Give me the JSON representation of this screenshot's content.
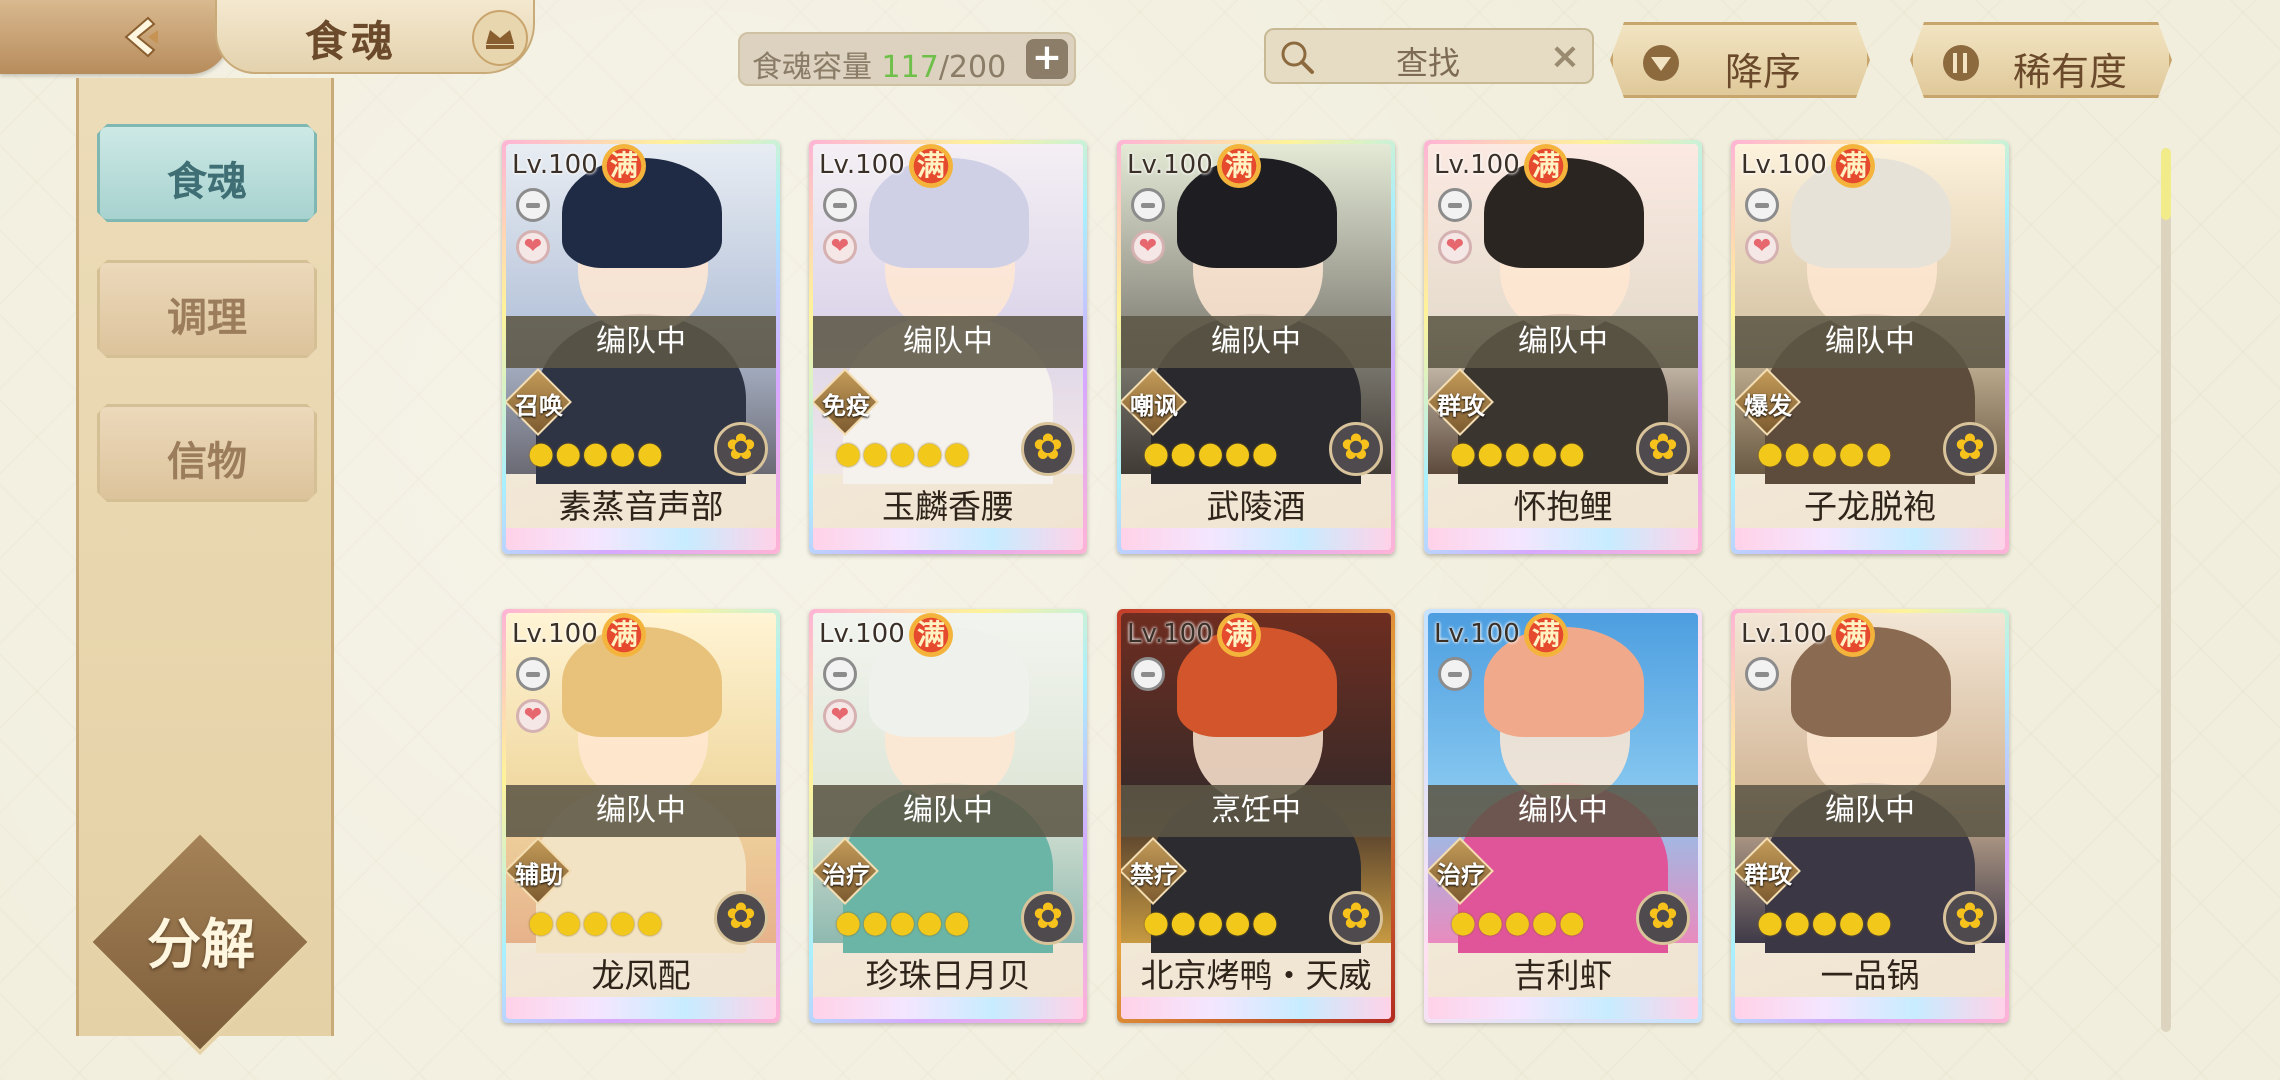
{
  "header": {
    "title": "食魂",
    "capacity_label": "食魂容量",
    "capacity_used": "117",
    "capacity_total": "200",
    "capacity_plus": "+",
    "search_placeholder": "查找",
    "search_clear": "×",
    "sort_label": "降序",
    "rarity_label": "稀有度"
  },
  "sidebar": {
    "items": [
      {
        "label": "食魂",
        "active": true
      },
      {
        "label": "调理",
        "active": false
      },
      {
        "label": "信物",
        "active": false
      }
    ],
    "decompose_label": "分解"
  },
  "common": {
    "max_badge": "满",
    "heart": "❤",
    "flower": "✿",
    "stars": "●●●●●"
  },
  "cards": [
    {
      "level": "Lv.100",
      "status": "编队中",
      "skill": "召唤",
      "name": "素蒸音声部"
    },
    {
      "level": "Lv.100",
      "status": "编队中",
      "skill": "免疫",
      "name": "玉麟香腰"
    },
    {
      "level": "Lv.100",
      "status": "编队中",
      "skill": "嘲讽",
      "name": "武陵酒"
    },
    {
      "level": "Lv.100",
      "status": "编队中",
      "skill": "群攻",
      "name": "怀抱鲤"
    },
    {
      "level": "Lv.100",
      "status": "编队中",
      "skill": "爆发",
      "name": "子龙脱袍"
    },
    {
      "level": "Lv.100",
      "status": "编队中",
      "skill": "辅助",
      "name": "龙凤配"
    },
    {
      "level": "Lv.100",
      "status": "编队中",
      "skill": "治疗",
      "name": "珍珠日月贝"
    },
    {
      "level": "Lv.100",
      "status": "烹饪中",
      "skill": "禁疗",
      "name": "北京烤鸭・天威"
    },
    {
      "level": "Lv.100",
      "status": "编队中",
      "skill": "治疗",
      "name": "吉利虾"
    },
    {
      "level": "Lv.100",
      "status": "编队中",
      "skill": "群攻",
      "name": "一品锅"
    }
  ]
}
